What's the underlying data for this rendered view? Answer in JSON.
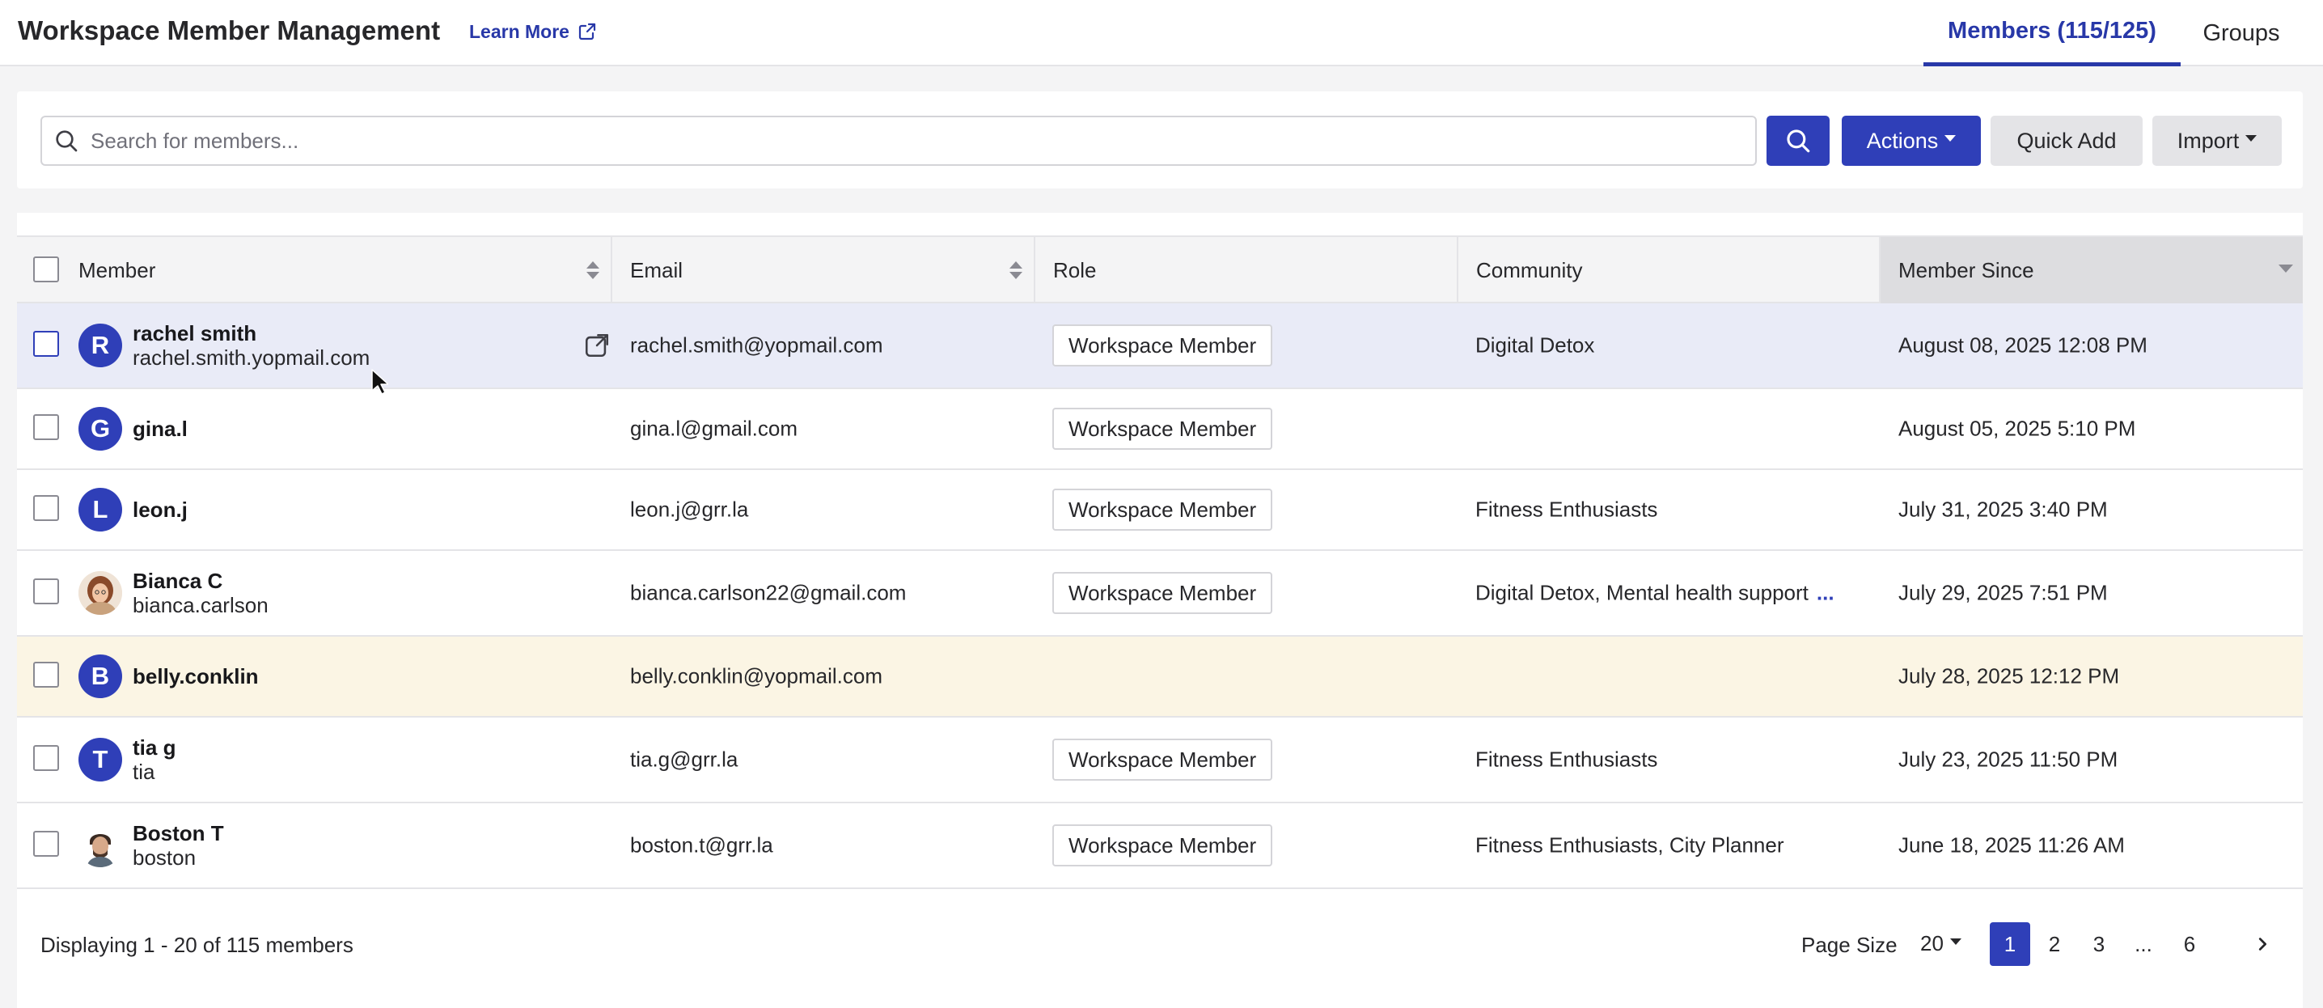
{
  "header": {
    "title": "Workspace Member Management",
    "learn_more": "Learn More",
    "tabs": [
      {
        "label": "Members (115/125)",
        "active": true
      },
      {
        "label": "Groups",
        "active": false
      }
    ]
  },
  "toolbar": {
    "search_placeholder": "Search for members...",
    "actions_label": "Actions",
    "quick_add_label": "Quick Add",
    "import_label": "Import"
  },
  "table": {
    "columns": [
      "Member",
      "Email",
      "Role",
      "Community",
      "Member Since"
    ],
    "rows": [
      {
        "initial": "R",
        "name": "rachel smith",
        "sub": "rachel.smith.yopmail.com",
        "email": "rachel.smith@yopmail.com",
        "role": "Workspace Member",
        "community": "Digital Detox",
        "since": "August 08, 2025 12:08 PM"
      },
      {
        "initial": "G",
        "name": "gina.l",
        "sub": "",
        "email": "gina.l@gmail.com",
        "role": "Workspace Member",
        "community": "",
        "since": "August 05, 2025 5:10 PM"
      },
      {
        "initial": "L",
        "name": "leon.j",
        "sub": "",
        "email": "leon.j@grr.la",
        "role": "Workspace Member",
        "community": "Fitness Enthusiasts",
        "since": "July 31, 2025 3:40 PM"
      },
      {
        "initial": "",
        "name": "Bianca C",
        "sub": "bianca.carlson",
        "email": "bianca.carlson22@gmail.com",
        "role": "Workspace Member",
        "community": "Digital Detox, Mental health support",
        "community_more": "...",
        "since": "July 29, 2025 7:51 PM"
      },
      {
        "initial": "B",
        "name": "belly.conklin",
        "sub": "",
        "email": "belly.conklin@yopmail.com",
        "role": "",
        "community": "",
        "since": "July 28, 2025 12:12 PM"
      },
      {
        "initial": "T",
        "name": "tia g",
        "sub": "tia",
        "email": "tia.g@grr.la",
        "role": "Workspace Member",
        "community": "Fitness Enthusiasts",
        "since": "July 23, 2025 11:50 PM"
      },
      {
        "initial": "",
        "name": "Boston T",
        "sub": "boston",
        "email": "boston.t@grr.la",
        "role": "Workspace Member",
        "community": "Fitness Enthusiasts, City Planner",
        "since": "June 18, 2025 11:26 AM"
      }
    ]
  },
  "footer": {
    "displaying": "Displaying 1 - 20 of 115 members",
    "page_size_label": "Page Size",
    "page_size_value": "20",
    "pages": [
      "1",
      "2",
      "3",
      "...",
      "6"
    ],
    "current_page": "1"
  },
  "colors": {
    "accent": "#2f3fb8",
    "selected_row": "#e9ebf7",
    "warning_row": "#fbf5e4"
  }
}
